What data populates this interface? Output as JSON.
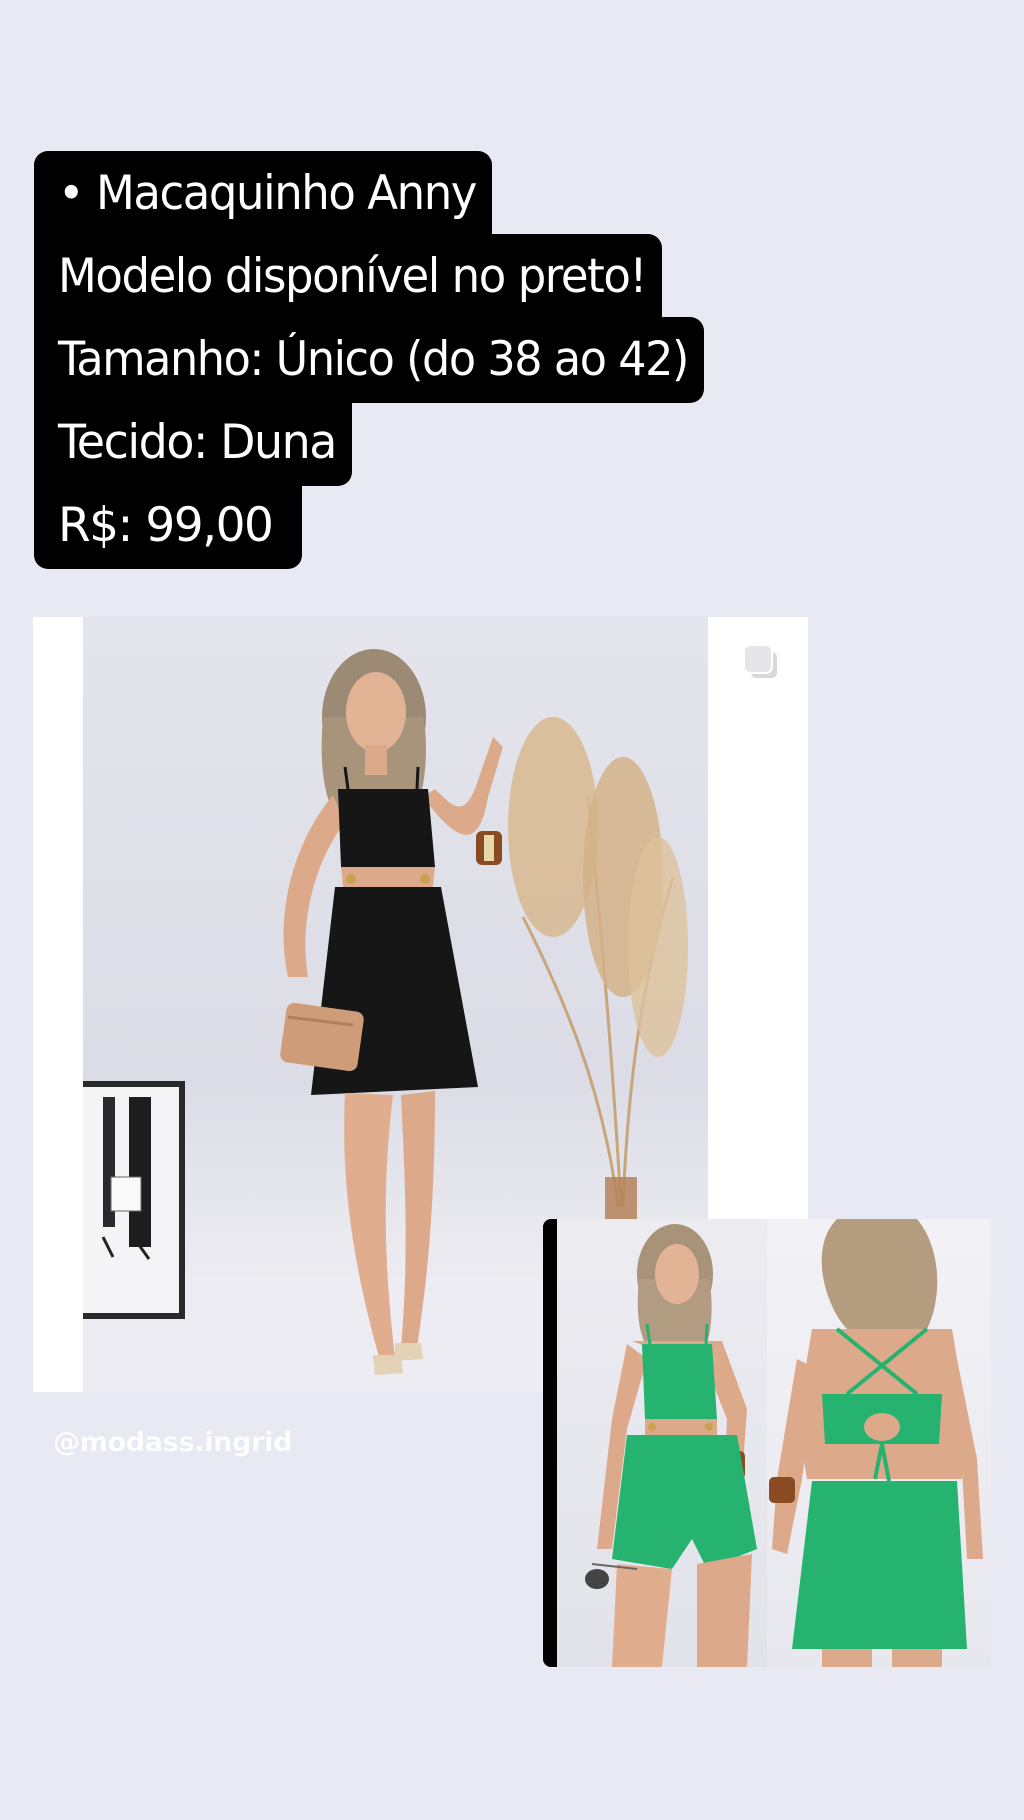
{
  "story": {
    "caption_lines": [
      "• Macaquinho Anny",
      "Modelo disponível no preto!",
      "Tamanho: Único (do 38 ao 42)",
      "Tecido: Duna",
      "R$: 99,00"
    ],
    "handle": "@modass.ingrid"
  },
  "product_photo": {
    "icon": "multiple-photos-icon"
  },
  "colors": {
    "background": "#e8e9f3",
    "caption_bg": "#000000",
    "caption_text": "#ffffff",
    "outfit_black": "#161616",
    "outfit_green": "#25b36f"
  }
}
